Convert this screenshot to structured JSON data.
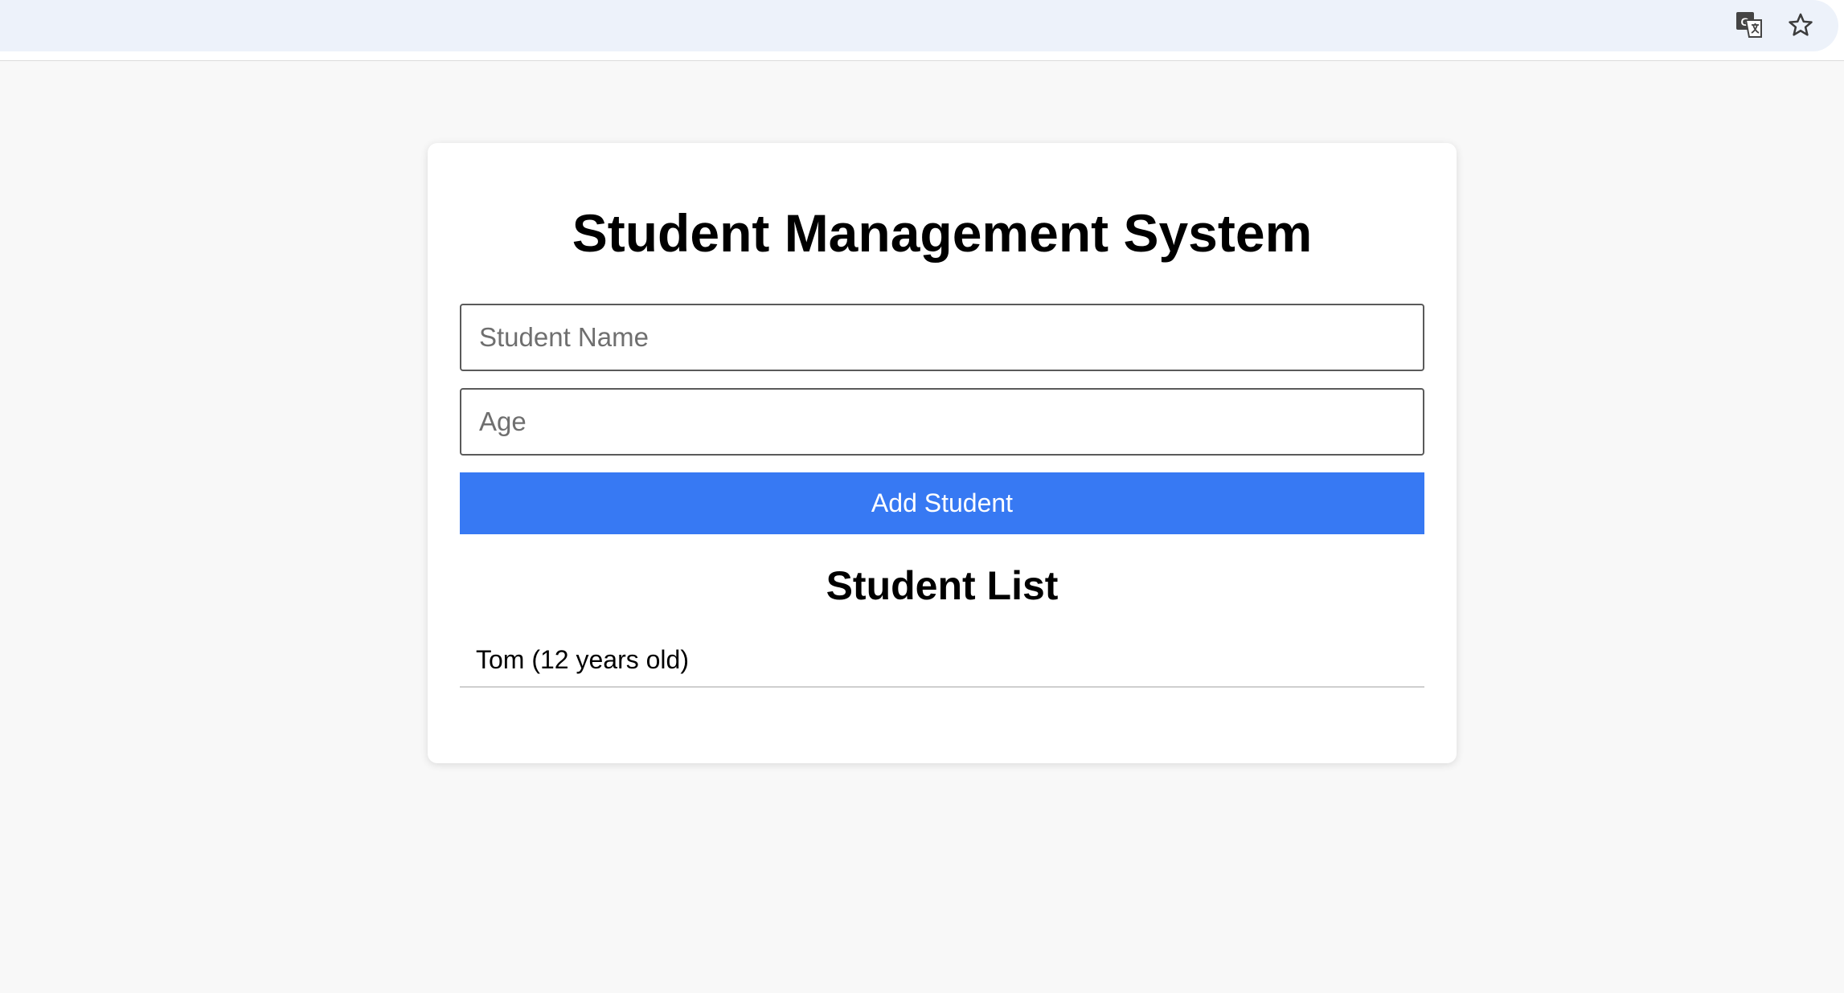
{
  "browser": {
    "icons": [
      "translate-icon",
      "star-icon"
    ]
  },
  "app": {
    "title": "Student Management System",
    "form": {
      "name_placeholder": "Student Name",
      "name_value": "",
      "age_placeholder": "Age",
      "age_value": "",
      "add_label": "Add Student"
    },
    "list": {
      "heading": "Student List",
      "items": [
        {
          "label": "Tom (12 years old)"
        }
      ]
    }
  },
  "colors": {
    "accent": "#3779f3",
    "page_bg": "#f8f8f8",
    "omnibox_bg": "#edf2fa"
  }
}
